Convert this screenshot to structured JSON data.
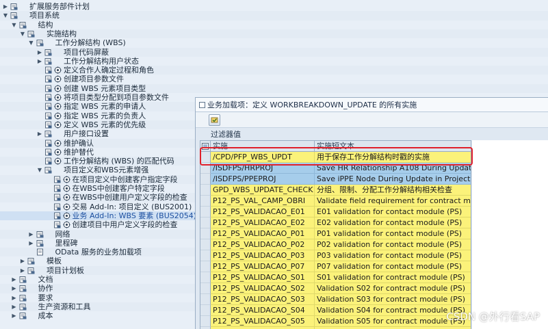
{
  "tree": [
    {
      "level": 0,
      "exp": "▶",
      "icon": "folder",
      "text": "扩展服务部件计划"
    },
    {
      "level": 0,
      "exp": "▼",
      "icon": "folder",
      "text": "项目系统"
    },
    {
      "level": 1,
      "exp": "▼",
      "icon": "folder",
      "text": "结构"
    },
    {
      "level": 2,
      "exp": "▼",
      "icon": "folder",
      "text": "实施结构"
    },
    {
      "level": 3,
      "exp": "▼",
      "icon": "folder",
      "text": "工作分解结构 (WBS)"
    },
    {
      "level": 4,
      "exp": "▶",
      "icon": "folder",
      "text": "项目代码屏蔽"
    },
    {
      "level": 4,
      "exp": "▶",
      "icon": "folder",
      "text": "工作分解结构用户状态"
    },
    {
      "level": 4,
      "exp": "",
      "icon": "doc-gear",
      "text": "定义合作人确定过程和角色"
    },
    {
      "level": 4,
      "exp": "",
      "icon": "doc-gear",
      "text": "创建项目参数文件"
    },
    {
      "level": 4,
      "exp": "",
      "icon": "doc-gear",
      "text": "创建 WBS 元素项目类型"
    },
    {
      "level": 4,
      "exp": "",
      "icon": "doc-gear",
      "text": "将项目类型分配到项目参数文件"
    },
    {
      "level": 4,
      "exp": "",
      "icon": "doc-gear",
      "text": "指定 WBS 元素的申请人"
    },
    {
      "level": 4,
      "exp": "",
      "icon": "doc-gear",
      "text": "指定 WBS 元素的负责人"
    },
    {
      "level": 4,
      "exp": "",
      "icon": "doc-gear",
      "text": "定义 WBS 元素的优先级"
    },
    {
      "level": 4,
      "exp": "▶",
      "icon": "folder",
      "text": "用户接口设置"
    },
    {
      "level": 4,
      "exp": "",
      "icon": "doc-gear",
      "text": "维护确认"
    },
    {
      "level": 4,
      "exp": "",
      "icon": "doc-gear",
      "text": "维护替代"
    },
    {
      "level": 4,
      "exp": "",
      "icon": "doc-gear",
      "text": "工作分解结构 (WBS) 的匹配代码"
    },
    {
      "level": 4,
      "exp": "▼",
      "icon": "folder",
      "text": "项目定义和WBS元素增强"
    },
    {
      "level": 5,
      "exp": "",
      "icon": "doc-gear",
      "text": "在项目定义中创建客户指定字段"
    },
    {
      "level": 5,
      "exp": "",
      "icon": "doc-gear",
      "text": "在WBS中创建客户特定字段"
    },
    {
      "level": 5,
      "exp": "",
      "icon": "doc-gear",
      "text": "在WBS中创建用户定义字段的检查"
    },
    {
      "level": 5,
      "exp": "",
      "icon": "doc-gear",
      "text": "交易 Add-In: 项目定义 (BUS2001)"
    },
    {
      "level": 5,
      "exp": "",
      "icon": "doc-gear",
      "text": "业务 Add-In: WBS 要素 (BUS2054)",
      "selected": true
    },
    {
      "level": 5,
      "exp": "",
      "icon": "doc-gear",
      "text": "创建项目中用户定义字段的检查"
    },
    {
      "level": 3,
      "exp": "▶",
      "icon": "folder",
      "text": "网络"
    },
    {
      "level": 3,
      "exp": "▶",
      "icon": "folder",
      "text": "里程碑"
    },
    {
      "level": 3,
      "exp": "",
      "icon": "doc",
      "text": "OData 服务的业务加载项"
    },
    {
      "level": 2,
      "exp": "▶",
      "icon": "folder",
      "text": "模板"
    },
    {
      "level": 2,
      "exp": "▶",
      "icon": "folder",
      "text": "项目计划板"
    },
    {
      "level": 1,
      "exp": "▶",
      "icon": "folder",
      "text": "文档"
    },
    {
      "level": 1,
      "exp": "▶",
      "icon": "folder",
      "text": "协作"
    },
    {
      "level": 1,
      "exp": "▶",
      "icon": "folder",
      "text": "要求"
    },
    {
      "level": 1,
      "exp": "▶",
      "icon": "folder",
      "text": "生产资源和工具"
    },
    {
      "level": 1,
      "exp": "▶",
      "icon": "folder",
      "text": "成本"
    }
  ],
  "dialog": {
    "title": "业务加载项：定义 WORKBREAKDOWN_UPDATE 的所有实施",
    "filter_label": "过滤器值",
    "columns": {
      "impl": "实施",
      "text": "实施短文本"
    },
    "rows": [
      {
        "impl": "/CPD/PFP_WBS_UPDT",
        "text": "用于保存工作分解结构时戳的实施",
        "style": "yellow"
      },
      {
        "impl": "/ISDFPS/HRPROJ",
        "text": "Save HR Relationship A108 During Update in",
        "style": "blue"
      },
      {
        "impl": "/ISDFPS/PPEPROJ",
        "text": "Save iPPE Node During Update in Project Buil",
        "style": "blue"
      },
      {
        "impl": "GPD_WBS_UPDATE_CHECK",
        "text": "分组、限制、分配工作分解结构相关检查",
        "style": "yellow"
      },
      {
        "impl": "P12_PS_VAL_CAMP_OBRI",
        "text": "Validate field requirement for contract modul",
        "style": "yellow"
      },
      {
        "impl": "P12_PS_VALIDACAO_E01",
        "text": "E01 validation for contact module (PS)",
        "style": "yellow"
      },
      {
        "impl": "P12_PS_VALIDACAO_E02",
        "text": "E02 validation for contact module (PS)",
        "style": "yellow"
      },
      {
        "impl": "P12_PS_VALIDACAO_P01",
        "text": "P01 validation for contact module (PS)",
        "style": "yellow"
      },
      {
        "impl": "P12_PS_VALIDACAO_P02",
        "text": "P02 validation for contact module (PS)",
        "style": "yellow"
      },
      {
        "impl": "P12_PS_VALIDACAO_P03",
        "text": "P03 validation for contact module (PS)",
        "style": "yellow"
      },
      {
        "impl": "P12_PS_VALIDACAO_P07",
        "text": "P07 validation for contact module (PS)",
        "style": "yellow"
      },
      {
        "impl": "P12_PS_VALIDACAO_S01",
        "text": "S01 validation for contract module (PS)",
        "style": "yellow"
      },
      {
        "impl": "P12_PS_VALIDACAO_S02",
        "text": "Validation S02 for contract module (PS)",
        "style": "yellow"
      },
      {
        "impl": "P12_PS_VALIDACAO_S03",
        "text": "Validation S03 for contract module (PS)",
        "style": "yellow"
      },
      {
        "impl": "P12_PS_VALIDACAO_S04",
        "text": "Validation S04 for contract module (PS)",
        "style": "yellow"
      },
      {
        "impl": "P12_PS_VALIDACAO_S05",
        "text": "Validation S05 for contract module (PS)",
        "style": "yellow"
      },
      {
        "impl": "P12_PS_VALIDACAO_S06",
        "text": "Validation S06 for contract module (PS)",
        "style": "yellow"
      }
    ]
  },
  "watermark": "CSDN @外行看SAP",
  "colors": {
    "row_yellow": "#fbf27a",
    "row_blue": "#a6cdeb",
    "highlight": "#e0202a"
  }
}
